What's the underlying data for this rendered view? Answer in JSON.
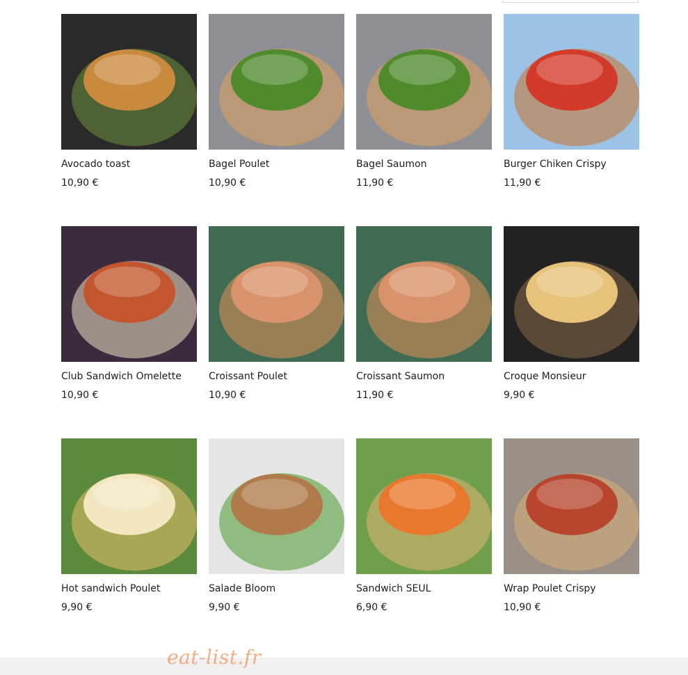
{
  "products": [
    {
      "name": "Avocado toast",
      "price": "10,90 €",
      "image": "avocado-toast-photo",
      "colors": [
        "#2a2a2a",
        "#6b8f3a",
        "#c98a3e"
      ]
    },
    {
      "name": "Bagel Poulet",
      "price": "10,90 €",
      "image": "bagel-poulet-photo",
      "colors": [
        "#8e8f95",
        "#e0a05c",
        "#4f8a2c"
      ]
    },
    {
      "name": "Bagel Saumon",
      "price": "11,90 €",
      "image": "bagel-saumon-photo",
      "colors": [
        "#8e8f95",
        "#e0a05c",
        "#4f8a2c"
      ]
    },
    {
      "name": "Burger Chiken Crispy",
      "price": "11,90 €",
      "image": "burger-chiken-crispy-photo",
      "colors": [
        "#9cc3e6",
        "#c8732e",
        "#d23a2a"
      ]
    },
    {
      "name": "Club Sandwich Omelette",
      "price": "10,90 €",
      "image": "club-sandwich-omelette-photo",
      "colors": [
        "#3b2b3e",
        "#f1e3c6",
        "#c3562e"
      ]
    },
    {
      "name": "Croissant Poulet",
      "price": "10,90 €",
      "image": "croissant-poulet-photo",
      "colors": [
        "#3f6b52",
        "#e3905a",
        "#d8936a"
      ]
    },
    {
      "name": "Croissant Saumon",
      "price": "11,90 €",
      "image": "croissant-saumon-photo",
      "colors": [
        "#3f6b52",
        "#e3905a",
        "#d8936a"
      ]
    },
    {
      "name": "Croque Monsieur",
      "price": "9,90 €",
      "image": "croque-monsieur-photo",
      "colors": [
        "#222222",
        "#8a6a4a",
        "#e6c27a"
      ]
    },
    {
      "name": "Hot sandwich Poulet",
      "price": "9,90 €",
      "image": "hot-sandwich-poulet-photo",
      "colors": [
        "#5c8a3c",
        "#e8c06a",
        "#f3e7c2"
      ]
    },
    {
      "name": "Salade Bloom",
      "price": "9,90 €",
      "image": "salade-bloom-photo",
      "colors": [
        "#e5e5e5",
        "#4c9a2e",
        "#b07a4a"
      ]
    },
    {
      "name": "Sandwich SEUL",
      "price": "6,90 €",
      "image": "sandwich-seul-photo",
      "colors": [
        "#6f9f4a",
        "#e0b27a",
        "#e8782e"
      ]
    },
    {
      "name": "Wrap Poulet Crispy",
      "price": "10,90 €",
      "image": "wrap-poulet-crispy-photo",
      "colors": [
        "#9a8f86",
        "#d9b07a",
        "#b8452e"
      ]
    }
  ],
  "watermark": {
    "text": "eat-list.fr",
    "color": "#f2a070"
  },
  "accent": "#1d1d1d"
}
